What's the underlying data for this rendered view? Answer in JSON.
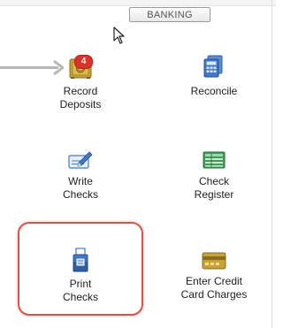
{
  "header": {
    "section_label": "BANKING"
  },
  "tasks": {
    "record_deposits": {
      "line1": "Record",
      "line2": "Deposits",
      "badge_count": "4",
      "icon": "deposit-safe-icon"
    },
    "reconcile": {
      "line1": "Reconcile",
      "icon": "reconcile-calculator-icon"
    },
    "write_checks": {
      "line1": "Write",
      "line2": "Checks",
      "icon": "write-checks-pen-icon"
    },
    "check_register": {
      "line1": "Check",
      "line2": "Register",
      "icon": "check-register-ledger-icon"
    },
    "print_checks": {
      "line1": "Print",
      "line2": "Checks",
      "icon": "printer-icon"
    },
    "enter_credit_card_charges": {
      "line1": "Enter Credit",
      "line2": "Card Charges",
      "icon": "credit-card-icon"
    }
  },
  "colors": {
    "highlight": "#d9534f",
    "badge": "#d9342b",
    "icon_blue": "#3f79c9",
    "icon_green": "#3f9e55",
    "icon_gold": "#c9a236"
  }
}
